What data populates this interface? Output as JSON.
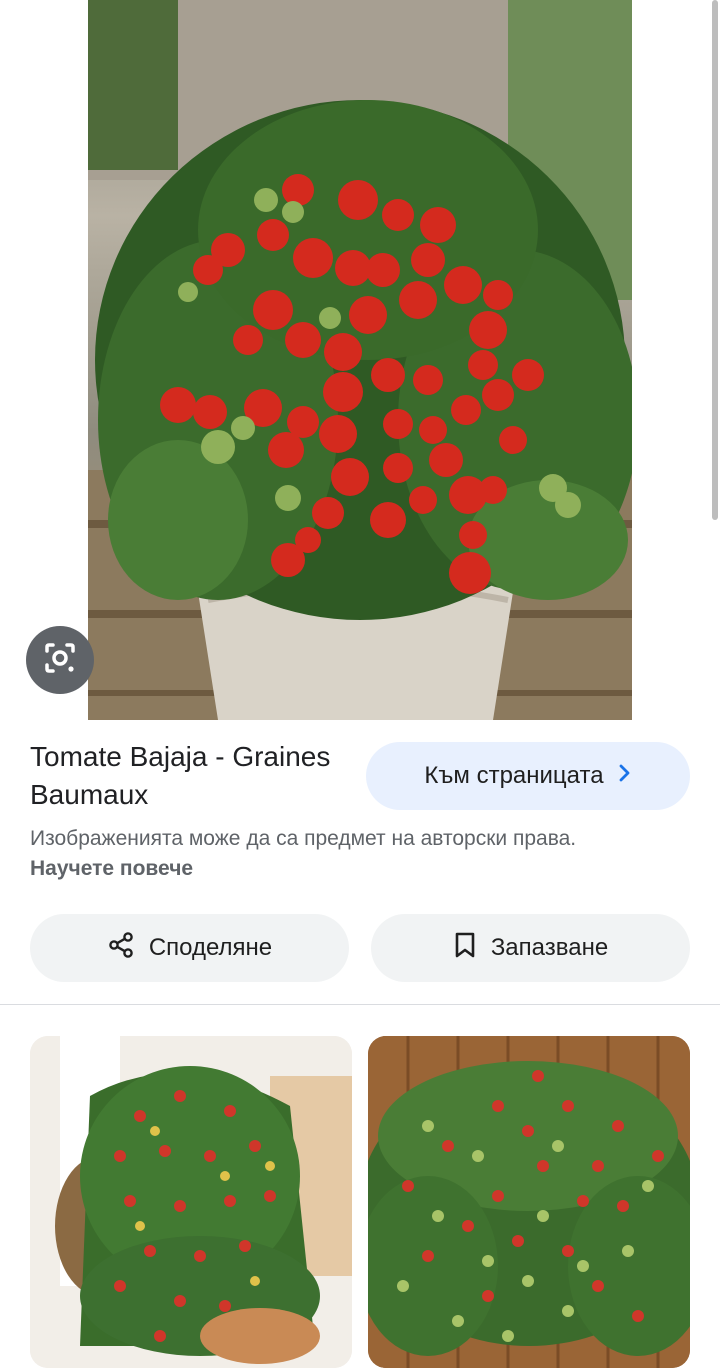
{
  "result": {
    "title": "Tomate Bajaja - Graines Baumaux",
    "visit_button": "Към страницата",
    "copyright_text": "Изображенията може да са предмет на авторски права.",
    "learn_more": "Научете повече"
  },
  "actions": {
    "share_label": "Споделяне",
    "save_label": "Запазване"
  },
  "icons": {
    "lens": "lens-icon",
    "chevron": "chevron-right-icon",
    "share": "share-icon",
    "save": "bookmark-icon"
  },
  "colors": {
    "visit_button_bg": "#e8f0fe",
    "chevron": "#1a73e8",
    "pill_bg": "#f1f3f4"
  }
}
